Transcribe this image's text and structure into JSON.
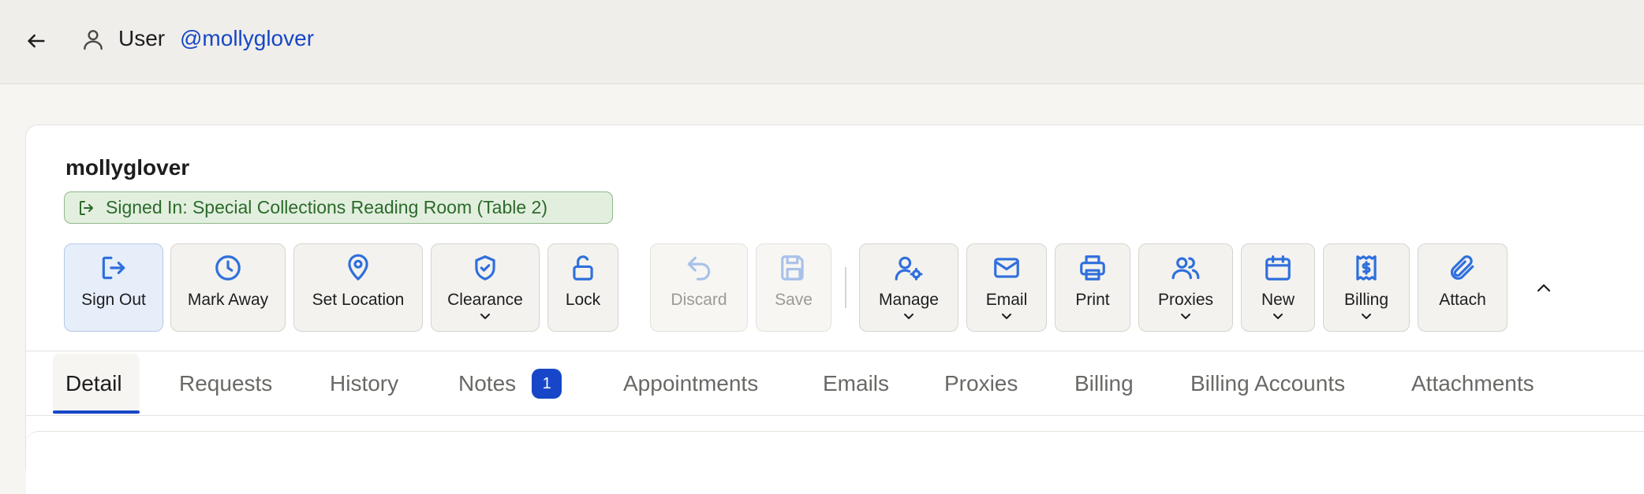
{
  "header": {
    "crumb_label": "User",
    "crumb_handle": "@mollyglover"
  },
  "user": {
    "username": "mollyglover",
    "signed_in_status": "Signed In: Special Collections Reading Room (Table 2)"
  },
  "toolbar": {
    "sign_out": "Sign Out",
    "mark_away": "Mark Away",
    "set_location": "Set Location",
    "clearance": "Clearance",
    "lock": "Lock",
    "discard": "Discard",
    "save": "Save",
    "manage": "Manage",
    "email": "Email",
    "print": "Print",
    "proxies": "Proxies",
    "new": "New",
    "billing": "Billing",
    "attach": "Attach"
  },
  "tabs": {
    "detail": "Detail",
    "requests": "Requests",
    "history": "History",
    "notes": "Notes",
    "notes_count": "1",
    "appointments": "Appointments",
    "emails": "Emails",
    "proxies": "Proxies",
    "billing": "Billing",
    "billing_accounts": "Billing Accounts",
    "attachments": "Attachments"
  },
  "colors": {
    "accent": "#1747c8",
    "icon_blue": "#2f6fdc",
    "success_bg": "#e2efdf",
    "success_text": "#2c6a2a"
  }
}
